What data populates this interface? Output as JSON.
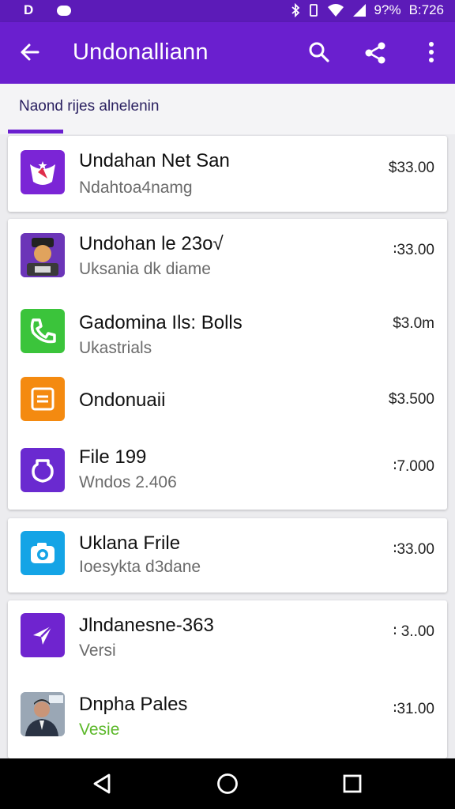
{
  "status": {
    "left_glyph": "D",
    "battery": "9?%",
    "time": "B:726"
  },
  "appbar": {
    "title": "Undonalliann",
    "icons": [
      "back-arrow-icon",
      "search-icon",
      "share-icon",
      "more-vert-icon"
    ]
  },
  "section": {
    "label": "Naond rijes alnelenin"
  },
  "colors": {
    "appbar": "#6a1fcf",
    "statusbar": "#5c1bb8",
    "subtitle_green": "#5cb82a"
  },
  "items": [
    {
      "name": "Undahan Net San",
      "subtitle": "Ndahtoa4namg",
      "price": "$33.00",
      "icon": "purple-star-icon"
    },
    {
      "name": "Undohan le 23o√",
      "subtitle": "Uksania dk diame",
      "price": "∶33.00",
      "icon": "photo-avatar-icon"
    },
    {
      "name": "Gadomina Ils: Bolls",
      "subtitle": "Ukastrials",
      "price": "$3.0m",
      "icon": "green-phone-icon"
    },
    {
      "name": "Ondonuaii",
      "subtitle": "",
      "price": "$3.500",
      "icon": "orange-document-icon"
    },
    {
      "name": "File 199",
      "subtitle": "Wndos 2.406",
      "price": "∶7.000",
      "icon": "purple-shield-icon"
    },
    {
      "name": "Uklana Frile",
      "subtitle": "Ioesykta d3dane",
      "price": "∶33.00",
      "icon": "blue-camera-icon"
    },
    {
      "name": "Jlndanesne-363",
      "subtitle": "Versi",
      "price": "∶ 3..00",
      "icon": "purple-send-icon"
    },
    {
      "name": "Dnpha Pales",
      "subtitle": "Vesie",
      "price": "∶31.00",
      "icon": "portrait-photo-icon"
    }
  ],
  "navbar": {
    "icons": [
      "back-triangle-icon",
      "home-circle-icon",
      "recents-square-icon"
    ]
  }
}
